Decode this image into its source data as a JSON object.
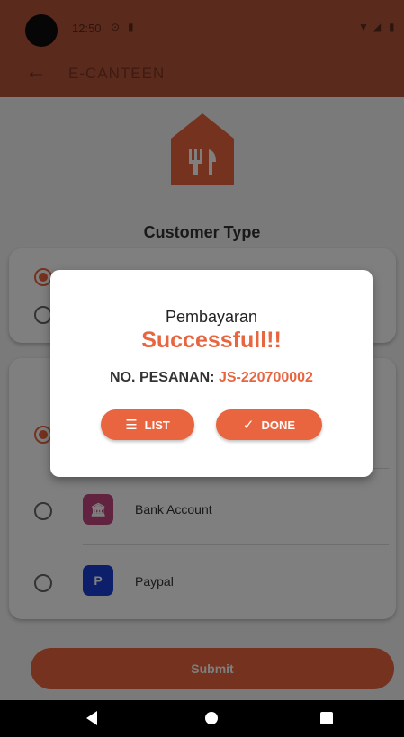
{
  "status_bar": {
    "time": "12:50",
    "icons": [
      "camera-icon",
      "notification-icon",
      "sd-card-icon",
      "wifi-icon",
      "signal-icon",
      "battery-icon"
    ]
  },
  "app_bar": {
    "title": "E-CANTEEN",
    "back_icon": "arrow-left-icon"
  },
  "main": {
    "logo_icon": "restaurant-fork-knife-house-icon",
    "customer_type_title": "Customer Type",
    "customer_type_selected_index": 0,
    "payment_options": [
      {
        "label": "Bank Account",
        "icon": "bank-icon",
        "color": "#c2467f",
        "selected": false
      },
      {
        "label": "Paypal",
        "icon": "paypal-icon",
        "color": "#1b3ed6",
        "selected": false
      }
    ],
    "payment_first_selected": true,
    "submit_label": "Submit"
  },
  "dialog": {
    "title": "Pembayaran",
    "success": "Successfull!!",
    "order_label": "NO. PESANAN:",
    "order_number": "JS-220700002",
    "list_button": {
      "label": "LIST",
      "icon": "list-icon"
    },
    "done_button": {
      "label": "DONE",
      "icon": "check-icon"
    }
  },
  "nav_bar": {
    "icons": [
      "back-triangle-icon",
      "home-circle-icon",
      "recents-square-icon"
    ]
  },
  "colors": {
    "accent": "#e8653f",
    "app_bar": "#b4553a",
    "bank": "#c2467f",
    "paypal": "#1b3ed6"
  }
}
